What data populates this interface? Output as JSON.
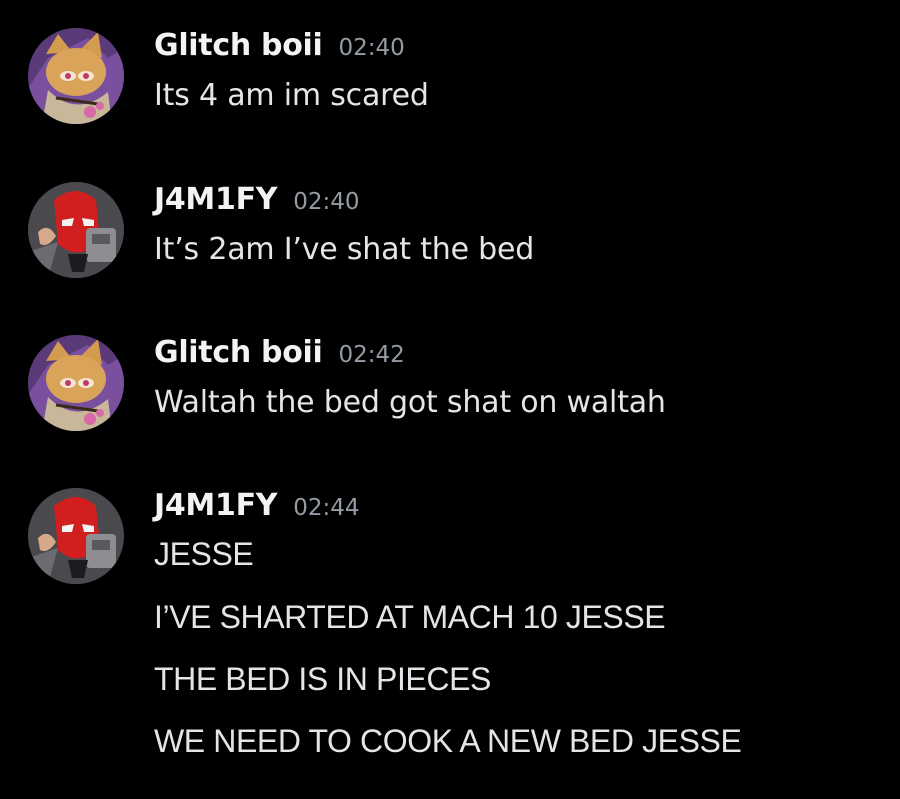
{
  "colors": {
    "background": "#000000",
    "username": "#f2f3f5",
    "timestamp": "#949ba4",
    "message_text": "#e3e5e8"
  },
  "messages": [
    {
      "avatar_icon": "fox-character-avatar-icon",
      "username": "Glitch boii",
      "time": "02:40",
      "lines": [
        "Its 4 am im scared"
      ]
    },
    {
      "avatar_icon": "red-hood-avatar-icon",
      "username": "J4M1FY",
      "time": "02:40",
      "lines": [
        "It’s 2am I’ve shat the bed"
      ]
    },
    {
      "avatar_icon": "fox-character-avatar-icon",
      "username": "Glitch boii",
      "time": "02:42",
      "lines": [
        "Waltah the bed got shat on waltah"
      ]
    },
    {
      "avatar_icon": "red-hood-avatar-icon",
      "username": "J4M1FY",
      "time": "02:44",
      "lines": [
        "JESSE",
        "I’VE SHARTED AT MACH 10 JESSE",
        "THE BED IS IN PIECES",
        "WE NEED TO COOK A NEW BED JESSE"
      ]
    }
  ]
}
